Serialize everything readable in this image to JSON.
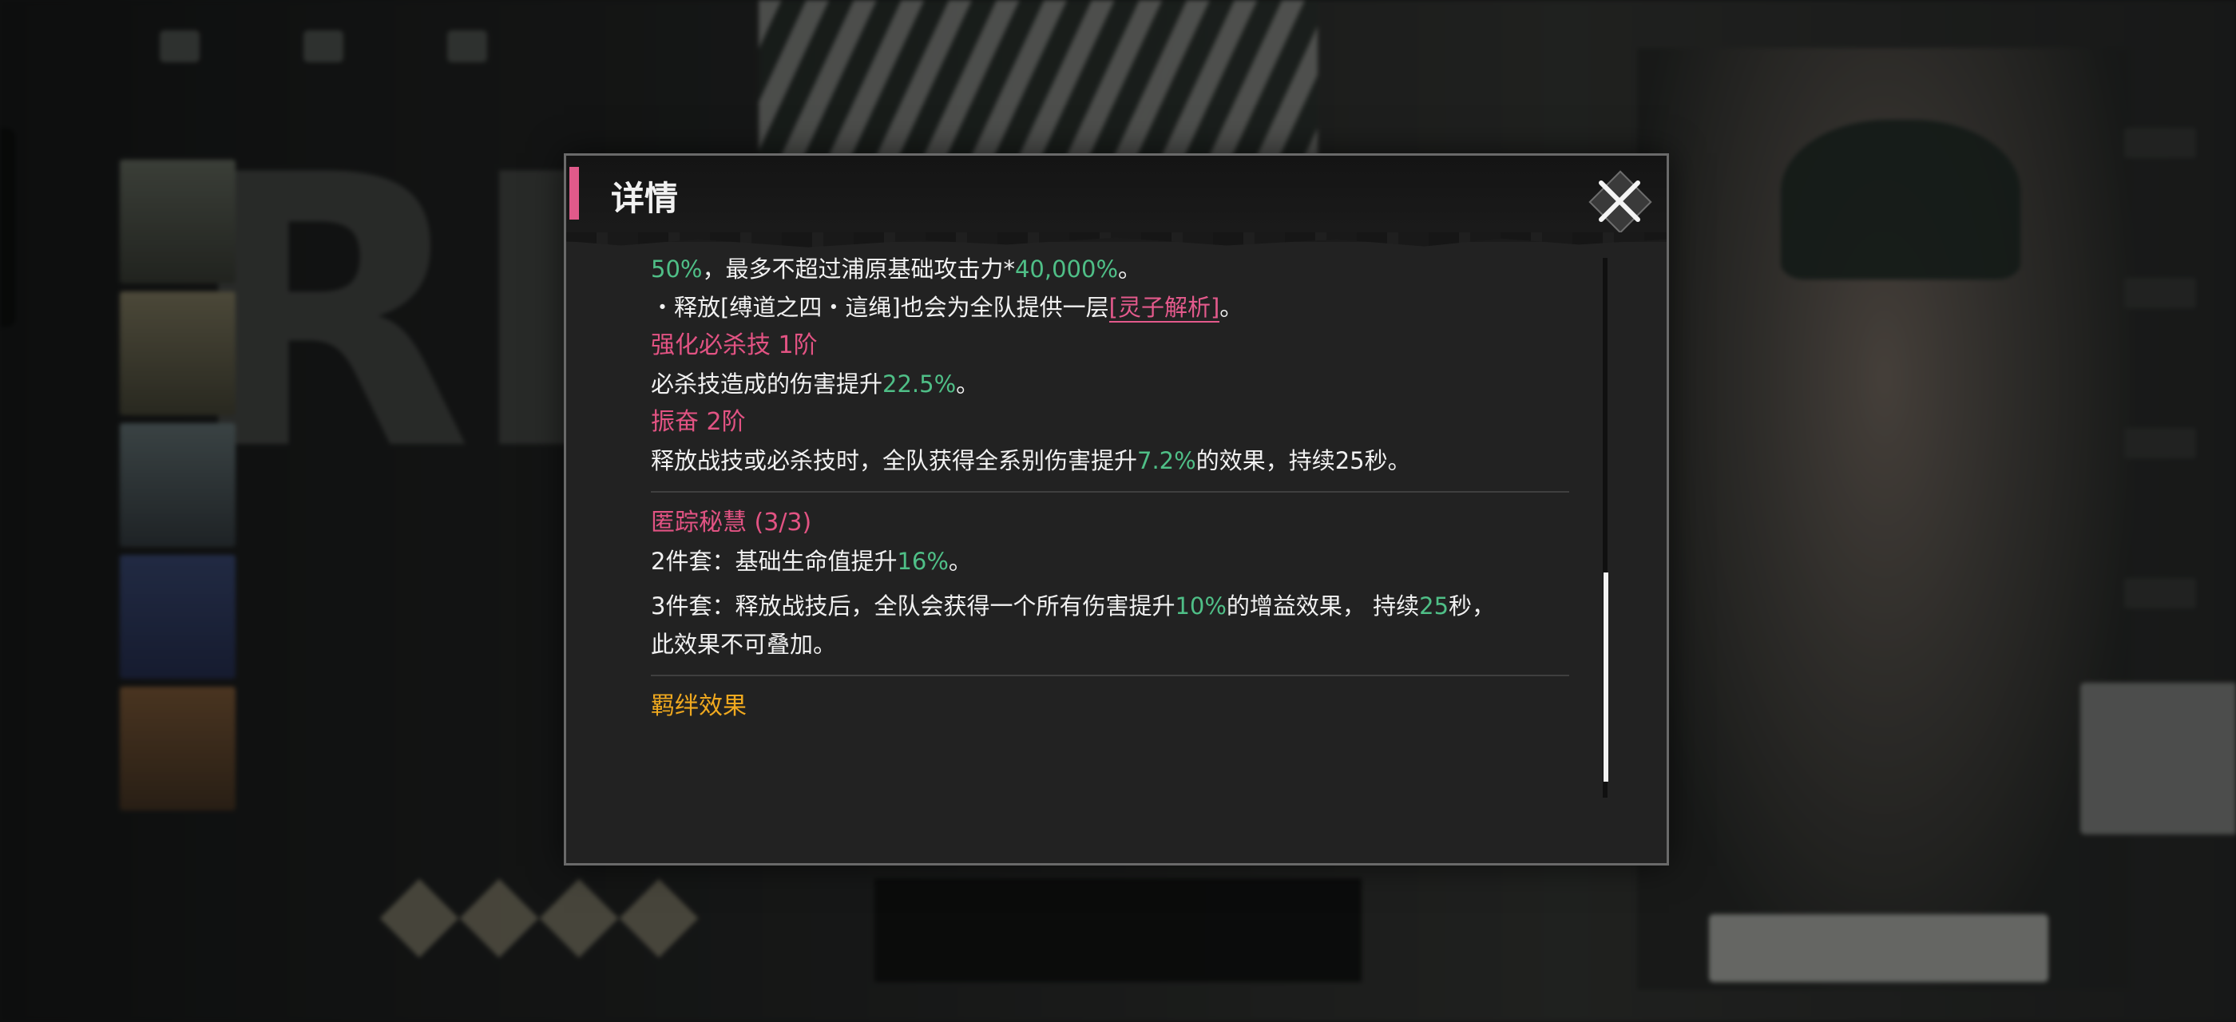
{
  "dialog": {
    "title": "详情"
  },
  "content": {
    "line1_num1": "50%",
    "line1_text": "，最多不超过浦原基础攻击力*",
    "line1_num2": "40,000%",
    "line1_end": "。",
    "line2_text": "・释放[缚道之四・這绳]也会为全队提供一层",
    "line2_link": "[灵子解析]",
    "line2_end": "。",
    "sections": [
      {
        "title": "强化必杀技 1阶",
        "desc_pre": "必杀技造成的伤害提升",
        "desc_num": "22.5%",
        "desc_post": "。"
      },
      {
        "title": "振奋 2阶",
        "desc_pre": "释放战技或必杀技时，全队获得全系别伤害提升",
        "desc_num": "7.2%",
        "desc_post": "的效果，持续25秒。"
      }
    ],
    "set": {
      "title": "匿踪秘慧 (3/3)",
      "two_pre": "2件套：基础生命值提升",
      "two_num": "16%",
      "two_post": "。",
      "three_pre": "3件套：释放战技后，全队会获得一个所有伤害提升",
      "three_num1": "10%",
      "three_mid": "的增益效果， 持续",
      "three_num2": "25",
      "three_post": "秒，",
      "three_line2": "此效果不可叠加。"
    },
    "bond_title": "羁绊效果"
  },
  "colors": {
    "accent_pink": "#e25383",
    "value_green": "#4fbf87",
    "bond_gold": "#f0a91f"
  },
  "icons": {
    "close": "close-x-icon"
  }
}
